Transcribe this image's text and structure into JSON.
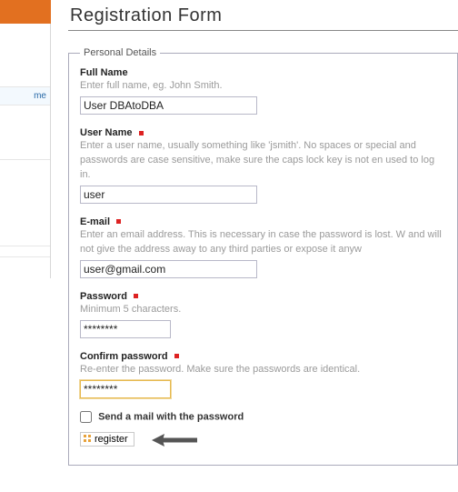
{
  "nav": {
    "item1": "me"
  },
  "page": {
    "title": "Registration Form"
  },
  "fieldset": {
    "legend": "Personal Details"
  },
  "fields": {
    "fullname": {
      "label": "Full Name",
      "hint": "Enter full name, eg. John Smith.",
      "value": "User DBAtoDBA",
      "required": false
    },
    "username": {
      "label": "User Name",
      "hint": "Enter a user name, usually something like 'jsmith'. No spaces or special and passwords are case sensitive, make sure the caps lock key is not en used to log in.",
      "value": "user",
      "required": true
    },
    "email": {
      "label": "E-mail",
      "hint": "Enter an email address. This is necessary in case the password is lost. W and will not give the address away to any third parties or expose it anyw",
      "value": "user@gmail.com",
      "required": true
    },
    "password": {
      "label": "Password",
      "hint": "Minimum 5 characters.",
      "value": "********",
      "required": true
    },
    "confirm": {
      "label": "Confirm password",
      "hint": "Re-enter the password. Make sure the passwords are identical.",
      "value": "********",
      "required": true
    }
  },
  "checkbox": {
    "label": "Send a mail with the password",
    "checked": false
  },
  "button": {
    "register": "register"
  }
}
